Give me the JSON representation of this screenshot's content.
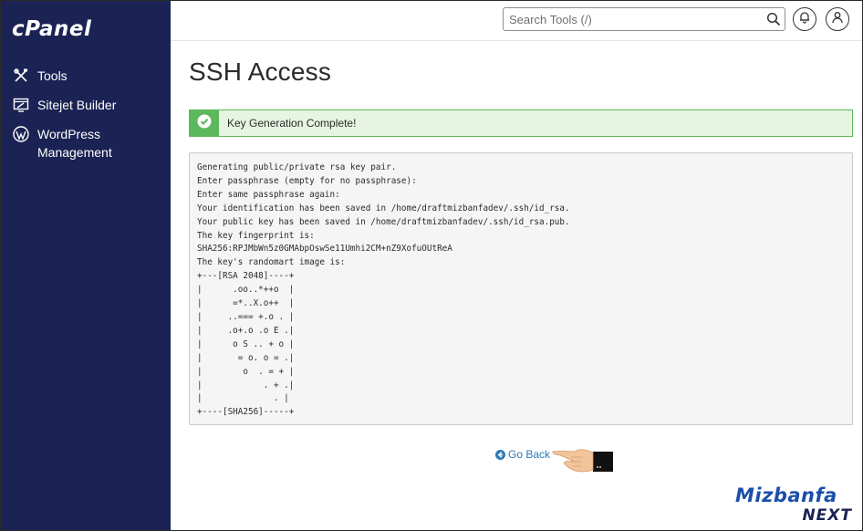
{
  "sidebar": {
    "logo": "cPanel",
    "items": [
      {
        "label": "Tools",
        "icon": "tools-icon"
      },
      {
        "label": "Sitejet Builder",
        "icon": "sitejet-icon"
      },
      {
        "label": "WordPress Management",
        "icon": "wordpress-icon"
      }
    ]
  },
  "topbar": {
    "search_placeholder": "Search Tools (/)",
    "icons": [
      "search-icon",
      "bell-icon",
      "user-icon"
    ]
  },
  "main": {
    "title": "SSH Access",
    "alert": {
      "text": "Key Generation Complete!",
      "status": "success",
      "color": "#5cb85c"
    },
    "output_lines": [
      "Generating public/private rsa key pair.",
      "Enter passphrase (empty for no passphrase):",
      "Enter same passphrase again:",
      "Your identification has been saved in /home/draftmizbanfadev/.ssh/id_rsa.",
      "Your public key has been saved in /home/draftmizbanfadev/.ssh/id_rsa.pub.",
      "The key fingerprint is:",
      "SHA256:RPJMbWn5z0GMAbpOswSe11Umhi2CM+nZ9XofuOUtReA",
      "The key's randomart image is:",
      "+---[RSA 2048]----+",
      "|      .oo..*++o  |",
      "|      =*..X.o++  |",
      "|     ..=== +.o . |",
      "|     .o+.o .o E .|",
      "|      o S .. + o |",
      "|       = o. o = .|",
      "|        o  . = + |",
      "|            . + .|",
      "|              . |",
      "+----[SHA256]-----+"
    ],
    "go_back_label": "Go Back"
  },
  "brand": {
    "name": "Mizbanfa",
    "tag": "NEXT"
  },
  "colors": {
    "sidebar_bg": "#1b2354",
    "link": "#2a7ab8",
    "success": "#5cb85c",
    "success_bg": "#e6f4e1"
  }
}
